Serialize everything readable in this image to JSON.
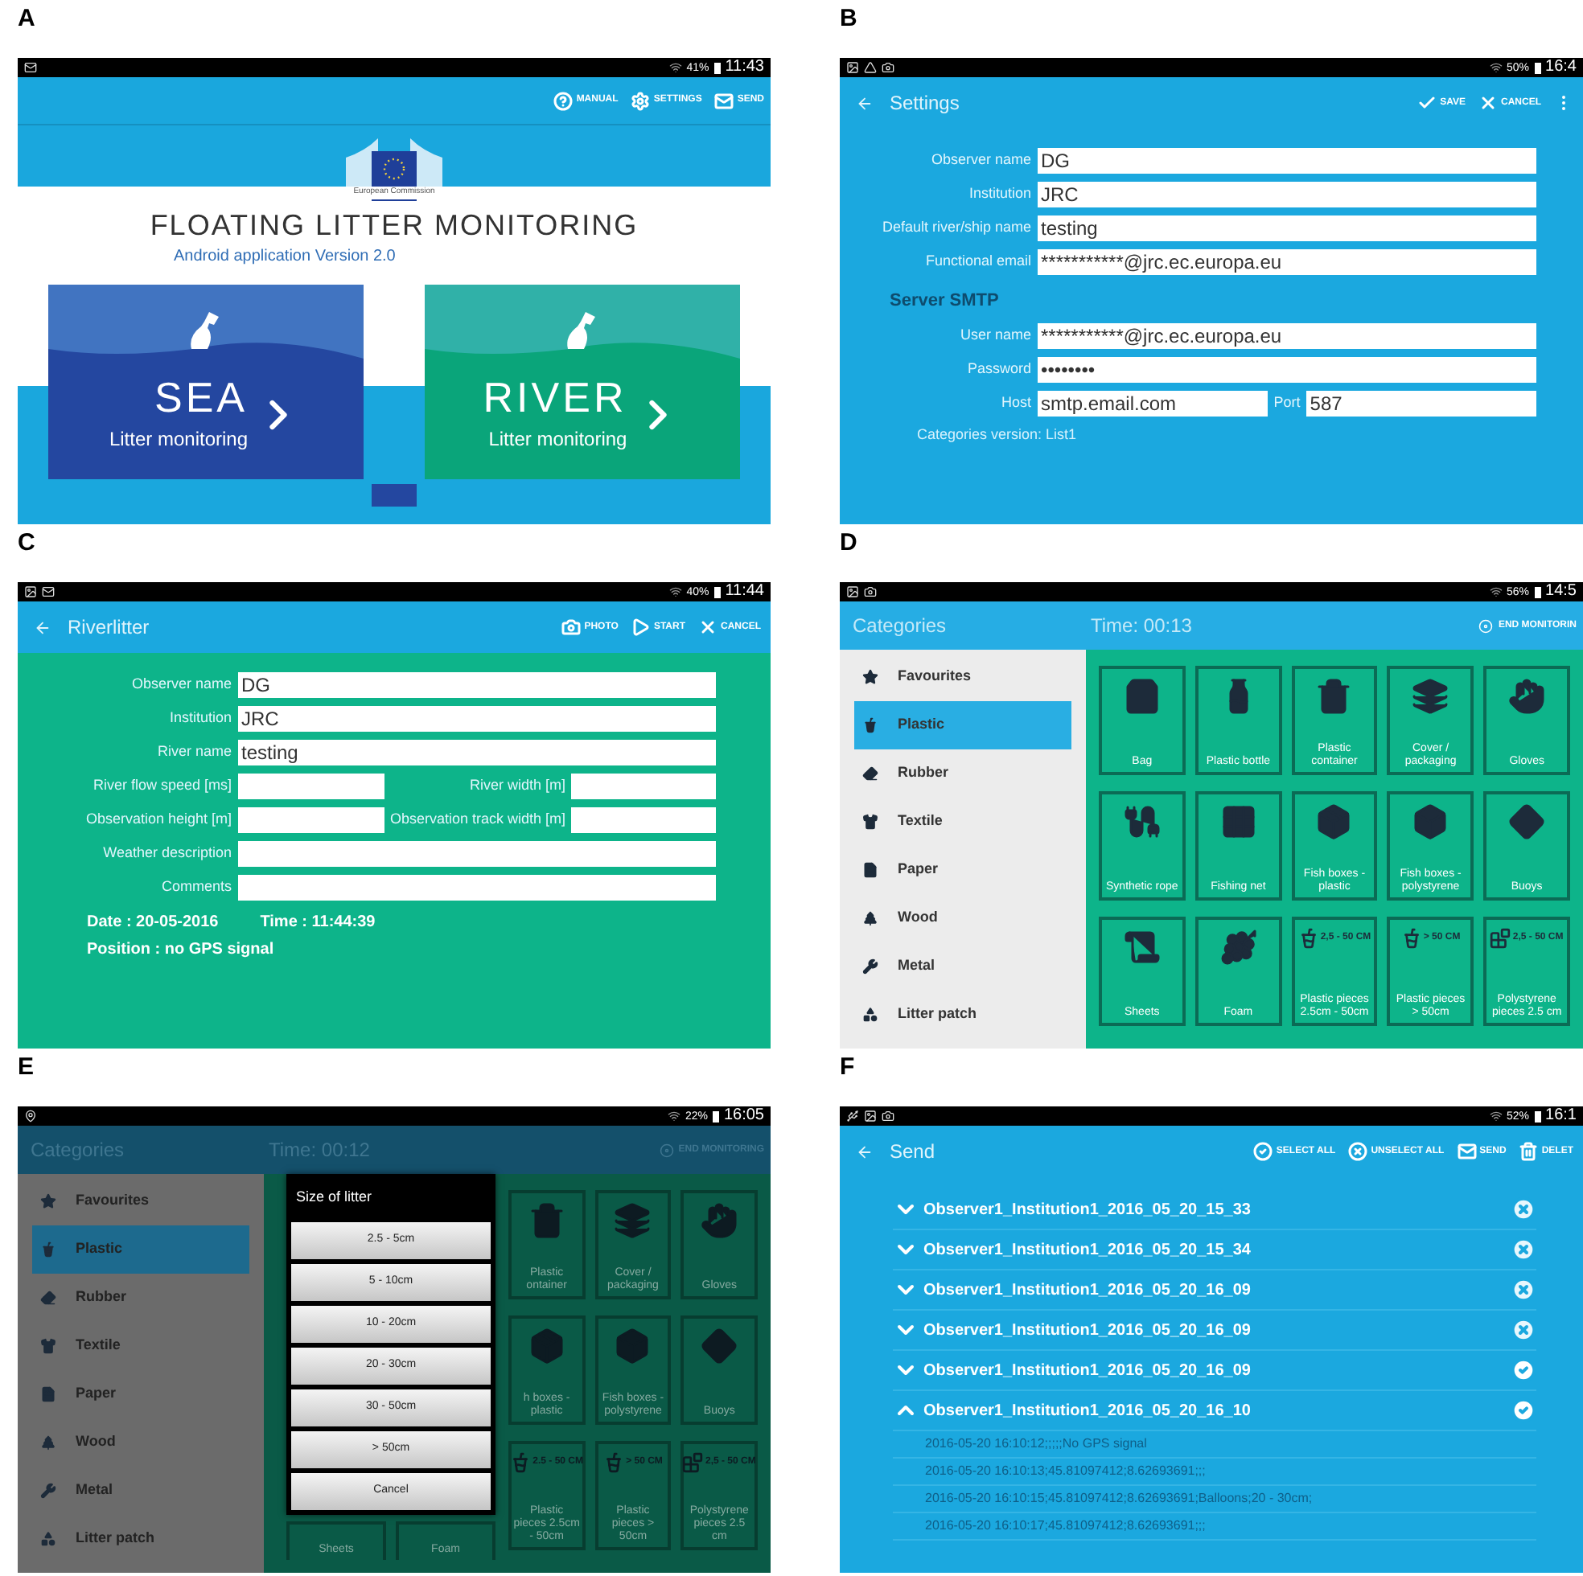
{
  "panels": [
    {
      "kind": "home",
      "letter": "A",
      "status": {
        "battery": "41%",
        "time": "11:43"
      },
      "actions": [
        "MANUAL",
        "SETTINGS",
        "SEND"
      ],
      "logo_caption": "European Commission",
      "title": "FLOATING LITTER MONITORING",
      "subtitle": "Android application Version 2.0",
      "cards": [
        {
          "title": "SEA",
          "subtitle": "Litter monitoring",
          "color": "#2447a0"
        },
        {
          "title": "RIVER",
          "subtitle": "Litter monitoring",
          "color": "#0aa57a"
        }
      ]
    },
    {
      "kind": "settings",
      "letter": "B",
      "status": {
        "battery": "50%",
        "time": "16:4"
      },
      "title": "Settings",
      "actions": [
        "SAVE",
        "CANCEL"
      ],
      "rows": [
        {
          "kind": "field",
          "label": "Observer name",
          "value": "DG"
        },
        {
          "kind": "field",
          "label": "Institution",
          "value": "JRC"
        },
        {
          "kind": "field",
          "label": "Default river/ship name",
          "value": "testing"
        },
        {
          "kind": "field",
          "label": "Functional email",
          "value": "***********@jrc.ec.europa.eu"
        },
        {
          "kind": "heading",
          "text": "Server SMTP"
        },
        {
          "kind": "field",
          "label": "User name",
          "value": "***********@jrc.ec.europa.eu"
        },
        {
          "kind": "field",
          "label": "Password",
          "value": "••••••••"
        },
        {
          "kind": "pair",
          "fields": [
            {
              "label": "Host",
              "value": "smtp.email.com"
            },
            {
              "label": "Port",
              "value": "587"
            }
          ]
        },
        {
          "kind": "note",
          "text": "Categories version: List1"
        }
      ]
    },
    {
      "kind": "river",
      "letter": "C",
      "status": {
        "battery": "40%",
        "time": "11:44"
      },
      "title": "Riverlitter",
      "actions": [
        "PHOTO",
        "START",
        "CANCEL"
      ],
      "rows": [
        {
          "kind": "field",
          "label": "Observer name",
          "value": "DG"
        },
        {
          "kind": "field",
          "label": "Institution",
          "value": "JRC"
        },
        {
          "kind": "field",
          "label": "River name",
          "value": "testing"
        },
        {
          "kind": "pair",
          "fields": [
            {
              "label": "River flow speed [ms]"
            },
            {
              "label": "River width [m]"
            }
          ]
        },
        {
          "kind": "pair",
          "fields": [
            {
              "label": "Observation height [m]"
            },
            {
              "label": "Observation track width [m]"
            }
          ]
        },
        {
          "kind": "field",
          "label": "Weather description"
        },
        {
          "kind": "field",
          "label": "Comments"
        }
      ],
      "date": "Date : 20-05-2016",
      "time": "Time : 11:44:39",
      "position": "Position : no GPS signal"
    },
    {
      "kind": "categories",
      "letter": "D",
      "dimmed": false,
      "status": {
        "battery": "56%",
        "time": "14:5"
      },
      "title": "Categories",
      "timer": "Time: 00:13",
      "end_action": "END MONITORIN",
      "categories": [
        {
          "label": "Favourites",
          "selected": false
        },
        {
          "label": "Plastic",
          "selected": true
        },
        {
          "label": "Rubber",
          "selected": false
        },
        {
          "label": "Textile",
          "selected": false
        },
        {
          "label": "Paper",
          "selected": false
        },
        {
          "label": "Wood",
          "selected": false
        },
        {
          "label": "Metal",
          "selected": false
        },
        {
          "label": "Litter patch",
          "selected": false
        }
      ],
      "tiles": [
        {
          "label": "Bag"
        },
        {
          "label": "Plastic bottle"
        },
        {
          "label": "Plastic container"
        },
        {
          "label": "Cover / packaging"
        },
        {
          "label": "Gloves"
        },
        {
          "label": "Synthetic rope"
        },
        {
          "label": "Fishing net"
        },
        {
          "label": "Fish boxes - plastic"
        },
        {
          "label": "Fish boxes - polystyrene"
        },
        {
          "label": "Buoys"
        },
        {
          "label": "Sheets"
        },
        {
          "label": "Foam"
        },
        {
          "label": "Plastic pieces 2.5cm - 50cm",
          "icon_text": "2,5 - 50 CM"
        },
        {
          "label": "Plastic pieces > 50cm",
          "icon_text": "> 50 CM"
        },
        {
          "label": "Polystyrene pieces 2.5 cm",
          "icon_text": "2,5 - 50 CM"
        }
      ]
    },
    {
      "kind": "categories",
      "letter": "E",
      "dimmed": true,
      "status": {
        "battery": "22%",
        "time": "16:05"
      },
      "title": "Categories",
      "timer": "Time: 00:12",
      "end_action": "END MONITORING",
      "categories": [
        {
          "label": "Favourites",
          "selected": false
        },
        {
          "label": "Plastic",
          "selected": true
        },
        {
          "label": "Rubber",
          "selected": false
        },
        {
          "label": "Textile",
          "selected": false
        },
        {
          "label": "Paper",
          "selected": false
        },
        {
          "label": "Wood",
          "selected": false
        },
        {
          "label": "Metal",
          "selected": false
        },
        {
          "label": "Litter patch",
          "selected": false
        }
      ],
      "dialog": {
        "title": "Size of litter",
        "options": [
          "2.5 - 5cm",
          "5 - 10cm",
          "10 - 20cm",
          "20 - 30cm",
          "30 - 50cm",
          "> 50cm"
        ],
        "cancel": "Cancel"
      },
      "under_dialog_tiles": [
        {
          "label": "Sheets"
        },
        {
          "label": "Foam"
        }
      ],
      "tiles": [
        {
          "label": "Plastic ontainer"
        },
        {
          "label": "Cover / packaging"
        },
        {
          "label": "Gloves"
        },
        {
          "label": "h boxes - plastic"
        },
        {
          "label": "Fish boxes - polystyrene"
        },
        {
          "label": "Buoys"
        },
        {
          "label": "Plastic pieces 2.5cm - 50cm",
          "icon_text": "2.5 - 50 CM"
        },
        {
          "label": "Plastic pieces > 50cm",
          "icon_text": "> 50 CM"
        },
        {
          "label": "Polystyrene pieces 2.5 cm",
          "icon_text": "2,5 - 50 CM"
        }
      ]
    },
    {
      "kind": "send",
      "letter": "F",
      "status": {
        "battery": "52%",
        "time": "16:1"
      },
      "title": "Send",
      "actions": [
        "SELECT ALL",
        "UNSELECT ALL",
        "SEND",
        "DELET"
      ],
      "files": [
        {
          "name": "Observer1_Institution1_2016_05_20_15_33",
          "expanded": false,
          "selected": false
        },
        {
          "name": "Observer1_Institution1_2016_05_20_15_34",
          "expanded": false,
          "selected": false
        },
        {
          "name": "Observer1_Institution1_2016_05_20_16_09",
          "expanded": false,
          "selected": false
        },
        {
          "name": "Observer1_Institution1_2016_05_20_16_09",
          "expanded": false,
          "selected": false
        },
        {
          "name": "Observer1_Institution1_2016_05_20_16_09",
          "expanded": false,
          "selected": true
        },
        {
          "name": "Observer1_Institution1_2016_05_20_16_10",
          "expanded": true,
          "selected": true,
          "records": [
            "2016-05-20 16:10:12;;;;;No GPS signal",
            "2016-05-20 16:10:13;45.81097412;8.62693691;;;",
            "2016-05-20 16:10:15;45.81097412;8.62693691;Balloons;20 - 30cm;",
            "2016-05-20 16:10:17;45.81097412;8.62693691;;;"
          ]
        }
      ]
    }
  ]
}
